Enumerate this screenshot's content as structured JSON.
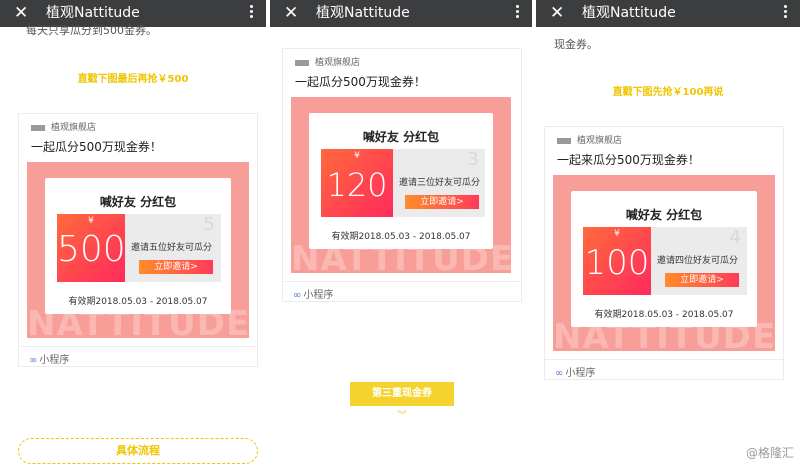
{
  "app_title": "植观Nattitude",
  "panel1": {
    "cut_text": "每天只享瓜分到500金券。",
    "note": "直戳下图最后再抢￥500",
    "card": {
      "shop": "植观旗舰店",
      "headline": "一起瓜分500万现金券！",
      "bag_title": "喊好友 分红包",
      "yen": "¥",
      "amount": "500",
      "slot_number": "5",
      "invite_text": "邀请五位好友可瓜分",
      "button": "立即邀请>",
      "validity": "有效期2018.05.03 - 2018.05.07",
      "watermark": "NATTITUDE",
      "mini_program": "小程序"
    },
    "pill": "具体流程"
  },
  "panel2": {
    "card": {
      "shop": "植观旗舰店",
      "headline": "一起瓜分500万现金券！",
      "bag_title": "喊好友 分红包",
      "yen": "¥",
      "amount": "120",
      "slot_number": "3",
      "invite_text": "邀请三位好友可瓜分",
      "button": "立即邀请>",
      "validity": "有效期2018.05.03 - 2018.05.07",
      "watermark": "NATTITUDE",
      "mini_program": "小程序"
    },
    "yellow_button": "第三重现金券",
    "chevrons": "︾"
  },
  "panel3": {
    "cut_text": "现金券。",
    "note": "直戳下图先抢￥100再说",
    "card": {
      "shop": "植观旗舰店",
      "headline": "一起来瓜分500万现金券！",
      "bag_title": "喊好友 分红包",
      "yen": "¥",
      "amount": "100",
      "slot_number": "4",
      "invite_text": "邀请四位好友可瓜分",
      "button": "立即邀请>",
      "validity": "有效期2018.05.03 - 2018.05.07",
      "watermark": "NATTITUDE",
      "mini_program": "小程序"
    },
    "watermark_text": "@格隆汇"
  },
  "colors": {
    "topbar": "#3c3d3f",
    "accent_yellow": "#f4d32e",
    "pink": "#f79e98",
    "coupon_red": "#ff2a5c"
  }
}
